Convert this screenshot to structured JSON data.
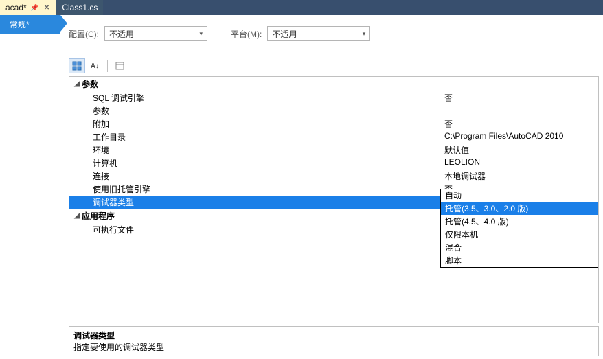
{
  "tabs": [
    {
      "label": "acad*",
      "active": true
    },
    {
      "label": "Class1.cs",
      "active": false
    }
  ],
  "rail": {
    "label": "常规*"
  },
  "config": {
    "cfg_label": "配置(C):",
    "cfg_value": "不适用",
    "plat_label": "平台(M):",
    "plat_value": "不适用"
  },
  "categories": {
    "params": "参数",
    "app": "应用程序"
  },
  "props": {
    "sql": {
      "k": "SQL 调试引擎",
      "v": "否"
    },
    "args": {
      "k": "参数",
      "v": ""
    },
    "attach": {
      "k": "附加",
      "v": "否"
    },
    "workdir": {
      "k": "工作目录",
      "v": "C:\\Program Files\\AutoCAD 2010"
    },
    "env": {
      "k": "环境",
      "v": "默认值"
    },
    "computer": {
      "k": "计算机",
      "v": "LEOLION"
    },
    "connect": {
      "k": "连接",
      "v": "本地调试器"
    },
    "legacy": {
      "k": "使用旧托管引擎",
      "v": "否"
    },
    "dbgtype": {
      "k": "调试器类型",
      "v": "托管(3.5、3.0、2.0 版)"
    },
    "exe": {
      "k": "可执行文件",
      "v": ""
    }
  },
  "options": {
    "o0": "自动",
    "o1": "托管(3.5、3.0、2.0 版)",
    "o2": "托管(4.5、4.0 版)",
    "o3": "仅限本机",
    "o4": "混合",
    "o5": "脚本"
  },
  "desc": {
    "title": "调试器类型",
    "body": "指定要使用的调试器类型"
  }
}
